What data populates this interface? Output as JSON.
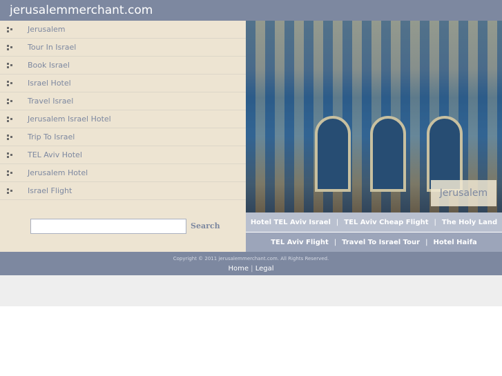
{
  "header": {
    "title": "jerusalemmerchant.com"
  },
  "menu": [
    {
      "label": "Jerusalem"
    },
    {
      "label": "Tour In Israel"
    },
    {
      "label": "Book Israel"
    },
    {
      "label": "Israel Hotel"
    },
    {
      "label": "Travel Israel"
    },
    {
      "label": "Jerusalem Israel Hotel"
    },
    {
      "label": "Trip To Israel"
    },
    {
      "label": "TEL Aviv Hotel"
    },
    {
      "label": "Jerusalem Hotel"
    },
    {
      "label": "Israel Flight"
    }
  ],
  "search": {
    "value": "",
    "button": "Search"
  },
  "hero": {
    "caption": "Jerusalem"
  },
  "links_row1": [
    "Hotel TEL Aviv Israel",
    "TEL Aviv Cheap Flight",
    "The Holy Land"
  ],
  "links_row2": [
    "TEL Aviv Flight",
    "Travel To Israel Tour",
    "Hotel Haifa"
  ],
  "separator": "|",
  "footer": {
    "copyright": "Copyright © 2011 jerusalemmerchant.com. All Rights Reserved.",
    "home": "Home",
    "legal": "Legal",
    "separator": "|"
  },
  "colors": {
    "header": "#7d88a0",
    "sidebar": "#ede4d2",
    "link_text": "#7d88a0"
  }
}
